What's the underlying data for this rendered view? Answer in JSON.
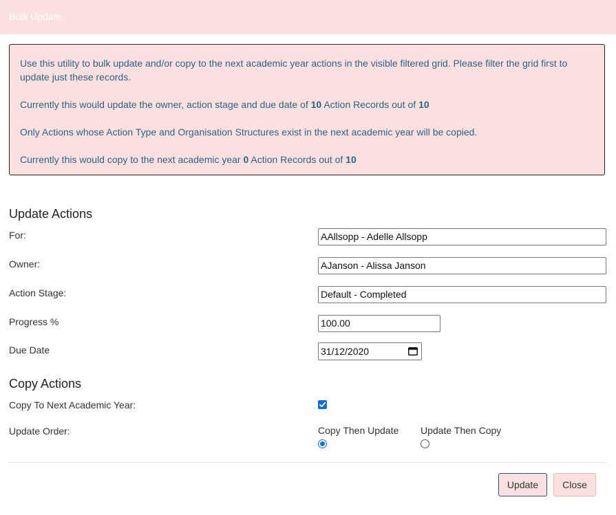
{
  "dialog": {
    "title": "Bulk Update"
  },
  "info": {
    "line1": "Use this utility to bulk update and/or copy to the next academic year actions in the visible filtered grid. Please filter the grid first to update just these records.",
    "update_prefix": "Currently this would update the owner, action stage and due date of",
    "update_count": "10",
    "update_middle": "Action Records out of",
    "update_total": "10",
    "copy_note": "Only Actions whose Action Type and Organisation Structures exist in the next academic year will be copied.",
    "copy_prefix": "Currently this would copy to the next academic year",
    "copy_count": "0",
    "copy_middle": "Action Records out of",
    "copy_total": "10"
  },
  "update_section": {
    "title": "Update Actions",
    "for_label": "For:",
    "for_value": "AAllsopp - Adelle Allsopp",
    "owner_label": "Owner:",
    "owner_value": "AJanson - Alissa Janson",
    "stage_label": "Action Stage:",
    "stage_value": "Default - Completed",
    "progress_label": "Progress %",
    "progress_value": "100.00",
    "due_label": "Due Date",
    "due_value": "31/12/2020"
  },
  "copy_section": {
    "title": "Copy Actions",
    "copy_next_label": "Copy To Next Academic Year:",
    "copy_next_checked": true,
    "order_label": "Update Order:",
    "option_copy_then_update": "Copy Then Update",
    "option_update_then_copy": "Update Then Copy",
    "selected_option": "Copy Then Update"
  },
  "buttons": {
    "update": "Update",
    "close": "Close"
  },
  "colors": {
    "accent": "#fde1e0",
    "info_text": "#2f5f86",
    "control_blue": "#0f6fd6"
  },
  "icons": {
    "date_picker": "calendar-icon",
    "checkbox": "checkmark-icon"
  }
}
